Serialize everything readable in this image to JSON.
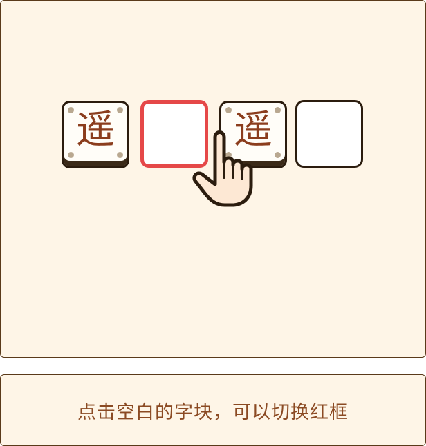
{
  "game": {
    "tiles": [
      {
        "type": "character",
        "char": "遥"
      },
      {
        "type": "empty",
        "selected": true
      },
      {
        "type": "character",
        "char": "遥"
      },
      {
        "type": "empty",
        "selected": false
      }
    ],
    "pointer_icon": "hand-pointer-icon"
  },
  "instruction": {
    "text": "点击空白的字块，可以切换红框"
  },
  "colors": {
    "panel_background": "#fef5e7",
    "panel_border": "#5a3a1a",
    "character_color": "#8b3d1d",
    "selected_border": "#e54848",
    "instruction_color": "#8b4a23"
  }
}
